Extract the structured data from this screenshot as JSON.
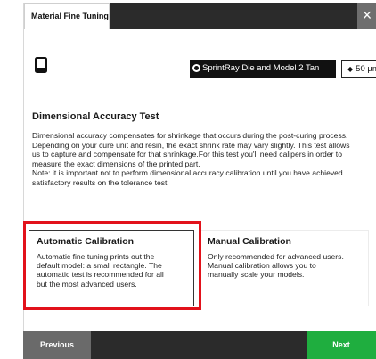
{
  "window": {
    "tab_label": "Material Fine Tuning",
    "close_glyph": "×"
  },
  "printer": {
    "icon": "printer-icon"
  },
  "resin_selector": {
    "label": "SprintRay Die and Model 2 Tan",
    "icon": "resin-drop-icon"
  },
  "layer_selector": {
    "label": "50 µm",
    "icon": "layer-icon"
  },
  "section": {
    "title": "Dimensional Accuracy Test",
    "description_lines": [
      "Dimensional accuracy compensates for shrinkage that occurs during the post-curing process.",
      "Depending on your cure unit and resin, the exact shrink rate may vary slightly. This test allows",
      "us to capture and compensate for that shrinkage.For this test you'll need calipers in order to",
      "measure the exact dimensions of the printed part.",
      "Note: it is important not to perform dimensional accuracy calibration until you have achieved",
      "satisfactory results on the tolerance test."
    ]
  },
  "options": {
    "automatic": {
      "title": "Automatic Calibration",
      "lines": [
        "Automatic fine tuning prints out the",
        "default model: a small rectangle. The",
        "automatic test is recommended for all",
        "but the most advanced users."
      ]
    },
    "manual": {
      "title": "Manual Calibration",
      "lines": [
        "Only recommended for advanced users.",
        "Manual calibration allows you to",
        "manually scale your models."
      ]
    }
  },
  "footer": {
    "previous_label": "Previous",
    "next_label": "Next"
  },
  "colors": {
    "highlight": "#e2121b",
    "next_button": "#1fae3f",
    "dark_bar": "#2b2b2b"
  }
}
